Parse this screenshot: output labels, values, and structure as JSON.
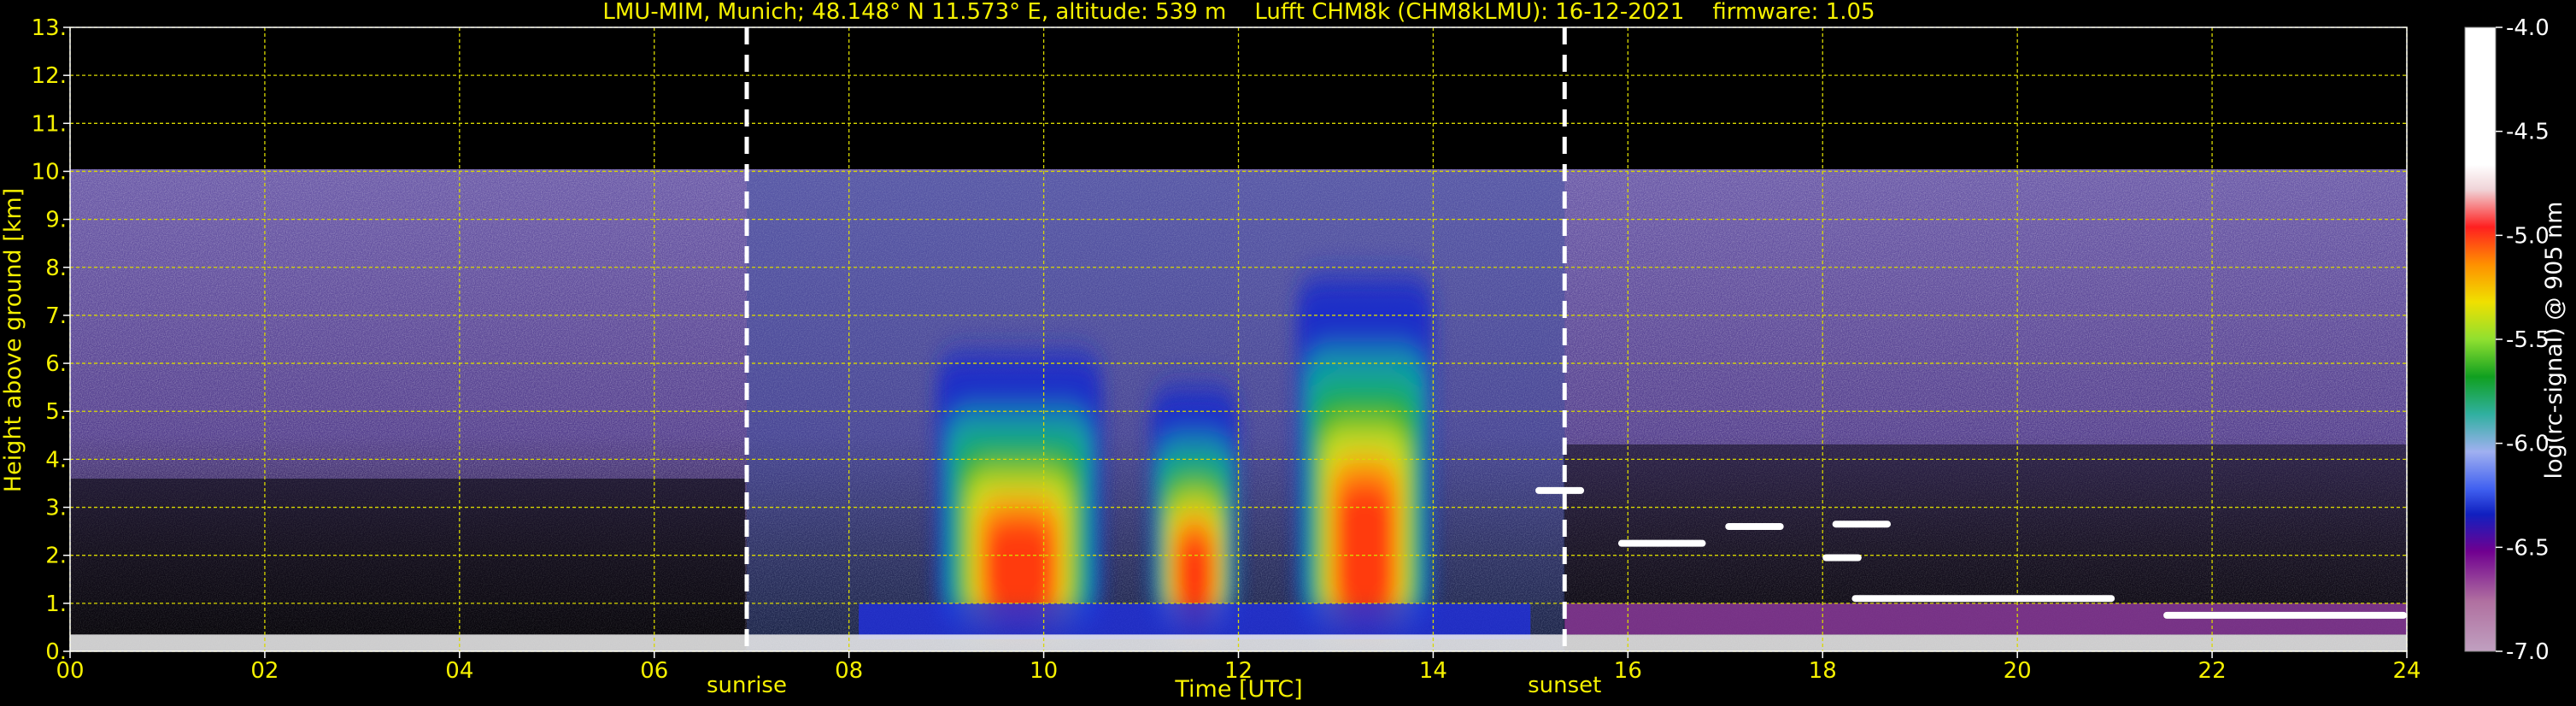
{
  "chart_data": {
    "type": "heatmap",
    "title": "LMU-MIM, Munich; 48.148° N 11.573° E, altitude: 539 m    Lufft CHM8k (CHM8kLMU): 16-12-2021    firmware: 1.05",
    "xlabel": "Time [UTC]",
    "ylabel": "Height above ground [km]",
    "xlim": [
      0,
      24
    ],
    "ylim": [
      0,
      13
    ],
    "x_ticks": [
      "00",
      "02",
      "04",
      "06",
      "08",
      "10",
      "12",
      "14",
      "16",
      "18",
      "20",
      "22",
      "24"
    ],
    "y_ticks": [
      "0.",
      "1.",
      "2.",
      "3.",
      "4.",
      "5.",
      "6.",
      "7.",
      "8.",
      "9.",
      "10.",
      "11.",
      "12.",
      "13."
    ],
    "grid": true,
    "max_range_km": 10,
    "markers": [
      {
        "label": "sunrise",
        "x": 6.95
      },
      {
        "label": "sunset",
        "x": 15.35
      }
    ],
    "colorbar": {
      "label": "log(rc-signal) @ 905 nm",
      "min": -7.0,
      "max": -4.0,
      "ticks": [
        "-4.0",
        "-4.5",
        "-5.0",
        "-5.5",
        "-6.0",
        "-6.5",
        "-7.0"
      ]
    },
    "signal_peaks": [
      {
        "x_start": 8.9,
        "x_end": 10.6,
        "y_max": 6.2
      },
      {
        "x_start": 11.1,
        "x_end": 12.0,
        "y_max": 5.5
      },
      {
        "x_start": 12.6,
        "x_end": 14.0,
        "y_max": 7.8
      }
    ],
    "cloud_layers": [
      {
        "x_start": 15.05,
        "x_end": 15.55,
        "y": 3.35
      },
      {
        "x_start": 15.9,
        "x_end": 16.8,
        "y": 2.25
      },
      {
        "x_start": 17.0,
        "x_end": 17.6,
        "y": 2.6
      },
      {
        "x_start": 18.1,
        "x_end": 18.7,
        "y": 2.65
      },
      {
        "x_start": 18.0,
        "x_end": 18.4,
        "y": 1.95
      },
      {
        "x_start": 18.3,
        "x_end": 21.0,
        "y": 1.1
      },
      {
        "x_start": 21.5,
        "x_end": 24.0,
        "y": 0.75
      }
    ]
  }
}
